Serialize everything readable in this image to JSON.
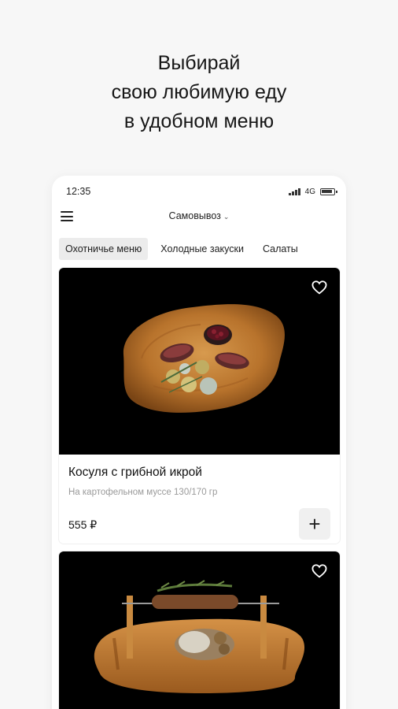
{
  "promo": {
    "line1": "Выбирай",
    "line2": "свою любимую еду",
    "line3": "в удобном меню"
  },
  "status_bar": {
    "time": "12:35",
    "network": "4G"
  },
  "app_bar": {
    "delivery_mode": "Самовывоз",
    "menu_icon": "hamburger-icon",
    "dropdown_icon": "chevron-down-icon"
  },
  "tabs": [
    {
      "label": "Охотничье меню",
      "active": true
    },
    {
      "label": "Холодные закуски",
      "active": false
    },
    {
      "label": "Салаты",
      "active": false
    }
  ],
  "dishes": [
    {
      "name": "Косуля с грибной икрой",
      "description": "На картофельном муссе 130/170 гр",
      "price": "555 ₽",
      "add_label": "+",
      "favorite_icon": "heart-outline-icon"
    },
    {
      "favorite_icon": "heart-outline-icon"
    }
  ],
  "colors": {
    "background": "#f7f7f7",
    "card": "#ffffff",
    "image_background": "#000000",
    "active_tab": "#ececec",
    "muted_text": "#9a9a9a"
  }
}
